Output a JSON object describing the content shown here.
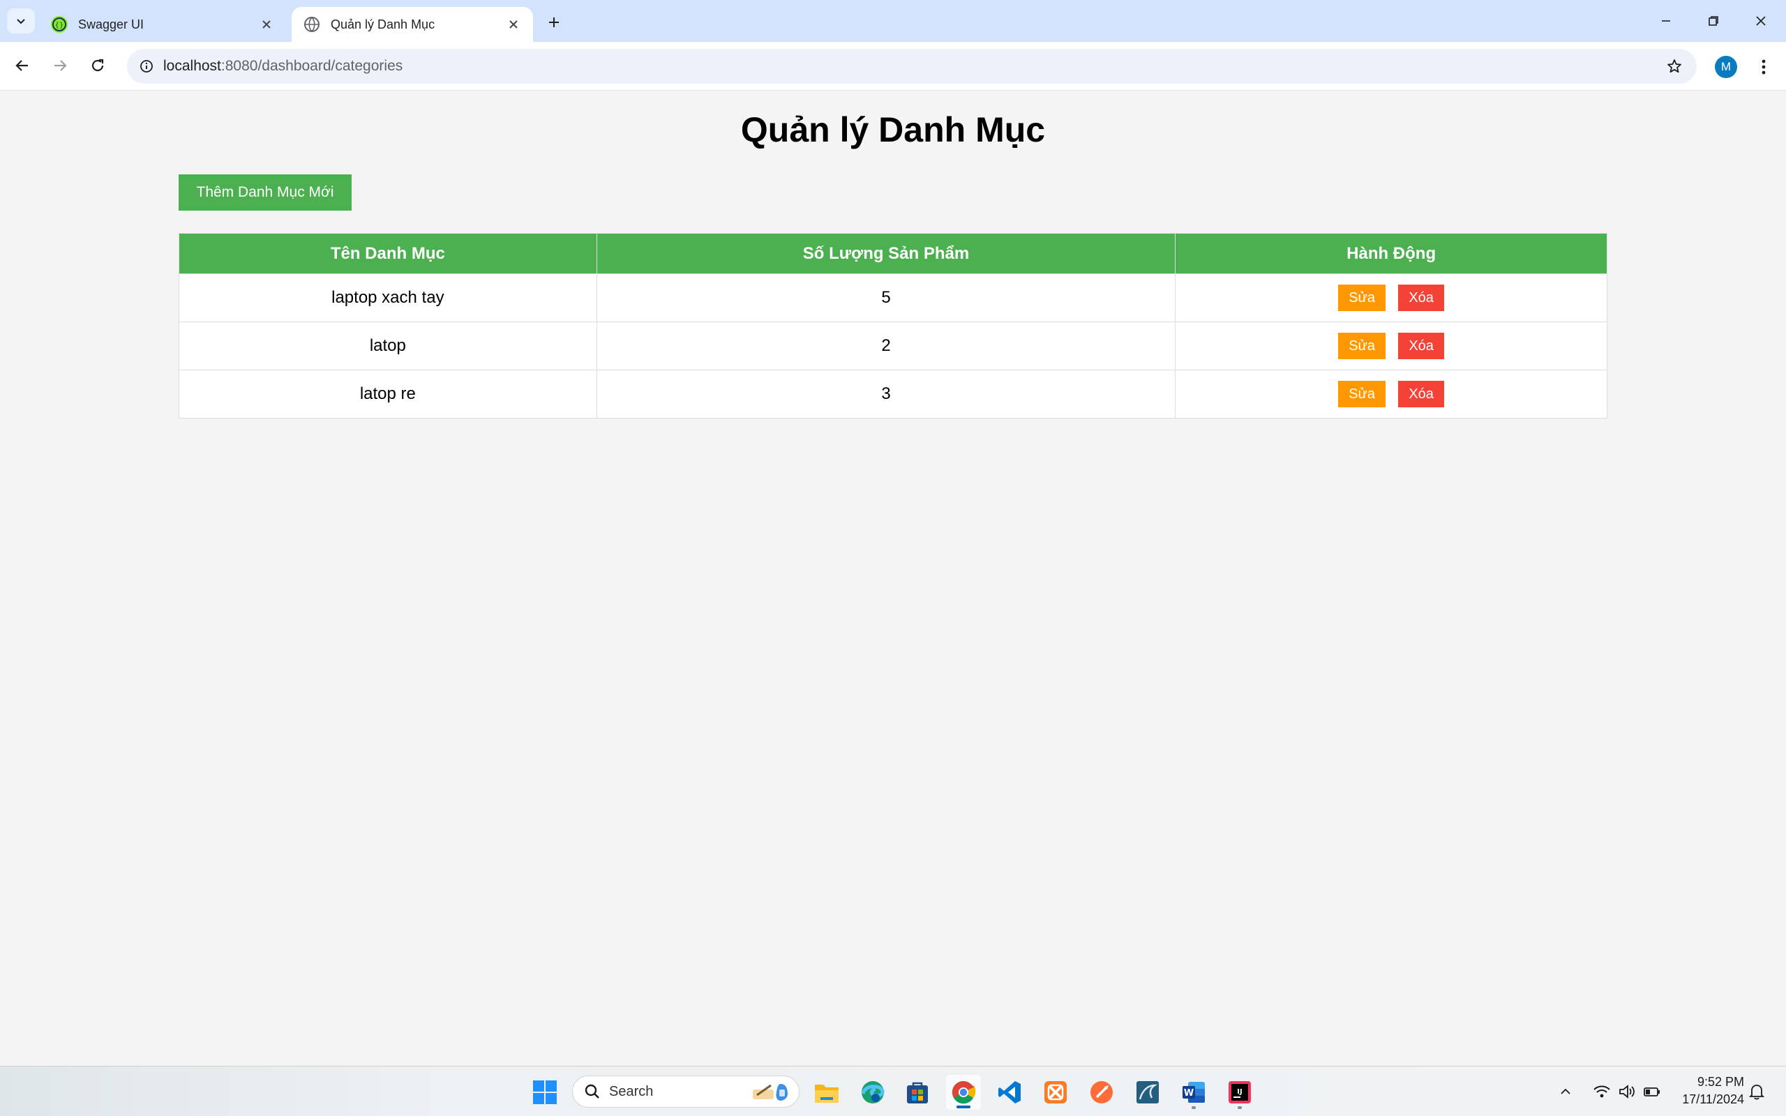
{
  "browser": {
    "tabs": [
      {
        "title": "Swagger UI",
        "active": false,
        "icon": "swagger-icon"
      },
      {
        "title": "Quản lý Danh Mục",
        "active": true,
        "icon": "globe-icon"
      }
    ],
    "url_host": "localhost",
    "url_path": ":8080/dashboard/categories",
    "profile_initial": "M"
  },
  "page": {
    "title": "Quản lý Danh Mục",
    "add_button_label": "Thêm Danh Mục Mới",
    "table": {
      "headers": [
        "Tên Danh Mục",
        "Số Lượng Sản Phẩm",
        "Hành Động"
      ],
      "rows": [
        {
          "name": "laptop xach tay",
          "quantity": "5",
          "edit_label": "Sửa",
          "delete_label": "Xóa"
        },
        {
          "name": "latop",
          "quantity": "2",
          "edit_label": "Sửa",
          "delete_label": "Xóa"
        },
        {
          "name": "latop re",
          "quantity": "3",
          "edit_label": "Sửa",
          "delete_label": "Xóa"
        }
      ]
    }
  },
  "taskbar": {
    "search_placeholder": "Search",
    "time": "9:52 PM",
    "date": "17/11/2024",
    "apps": [
      "windows-start-icon",
      "file-explorer-icon",
      "edge-icon",
      "store-icon",
      "chrome-icon",
      "vscode-icon",
      "xampp-icon",
      "postman-icon",
      "mysql-workbench-icon",
      "word-icon",
      "intellij-icon"
    ]
  },
  "colors": {
    "accent_green": "#4caf50",
    "edit_orange": "#ff9800",
    "delete_red": "#f44336"
  }
}
